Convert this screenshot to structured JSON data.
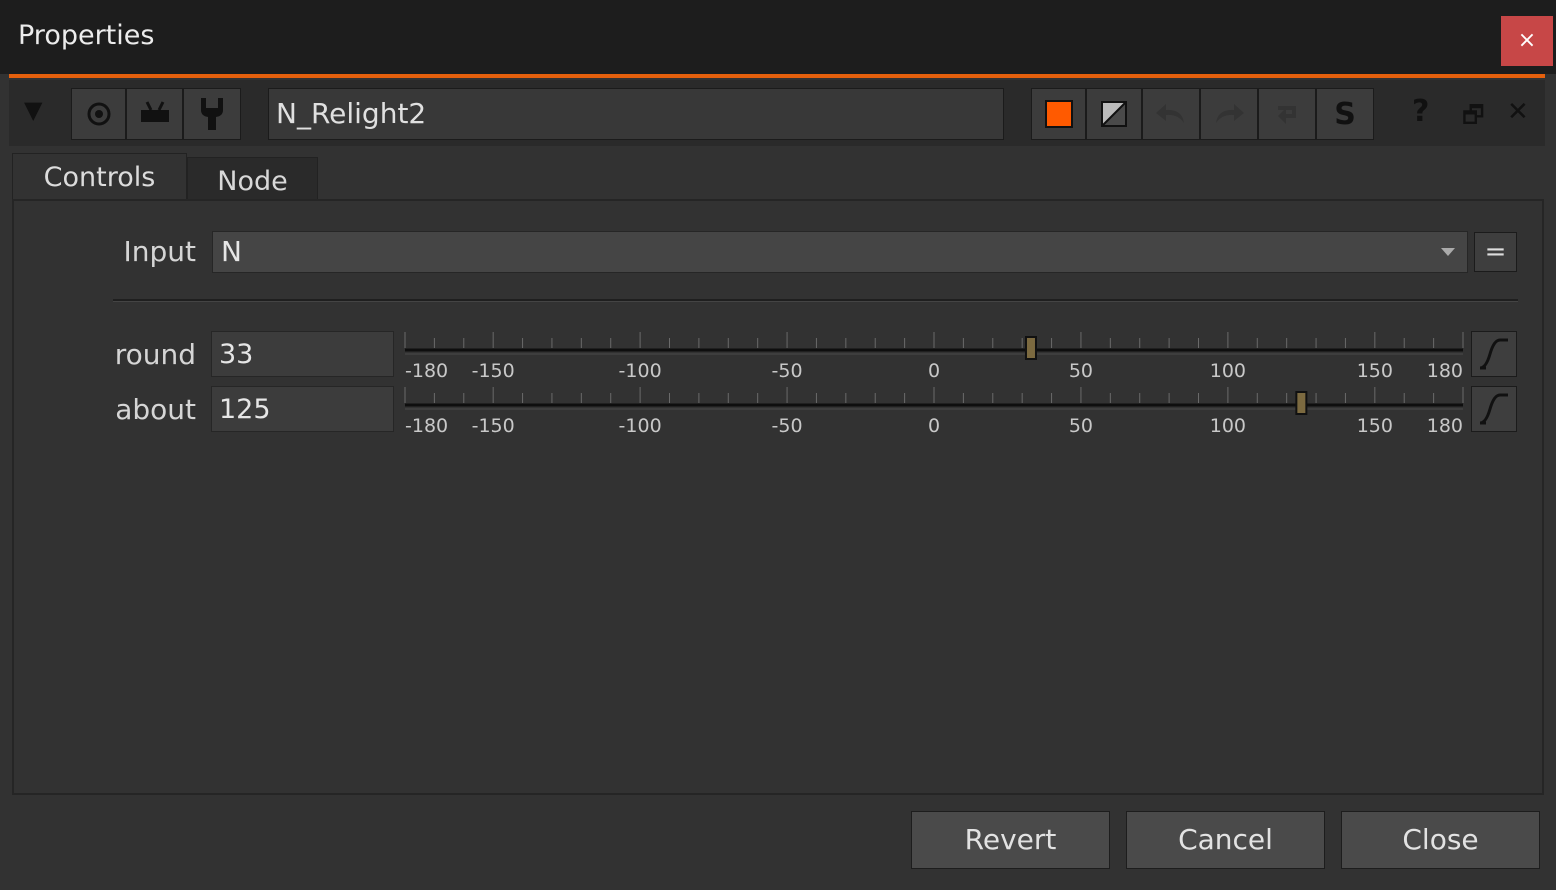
{
  "window": {
    "title": "Properties",
    "close_label": "×"
  },
  "toolbar": {
    "collapse_glyph": "▼",
    "node_name": "N_Relight2",
    "help_glyph": "?",
    "float_glyph": "🗗",
    "close_glyph": "✕",
    "colors": {
      "node_color": "#ff5a00",
      "accent": "#e5600d"
    }
  },
  "tabs": [
    {
      "label": "Controls",
      "active": true
    },
    {
      "label": "Node",
      "active": false
    }
  ],
  "controls": {
    "input": {
      "label": "Input",
      "value": "N",
      "eq_label": "="
    },
    "sliders": [
      {
        "label": "round",
        "value": "33",
        "pos": 33,
        "ticks": [
          "-180",
          "-150",
          "-100",
          "-50",
          "0",
          "50",
          "100",
          "150",
          "180"
        ]
      },
      {
        "label": "about",
        "value": "125",
        "pos": 125,
        "ticks": [
          "-180",
          "-150",
          "-100",
          "-50",
          "0",
          "50",
          "100",
          "150",
          "180"
        ]
      }
    ],
    "range": [
      -180,
      180
    ]
  },
  "footer": {
    "revert": "Revert",
    "cancel": "Cancel",
    "close": "Close"
  }
}
